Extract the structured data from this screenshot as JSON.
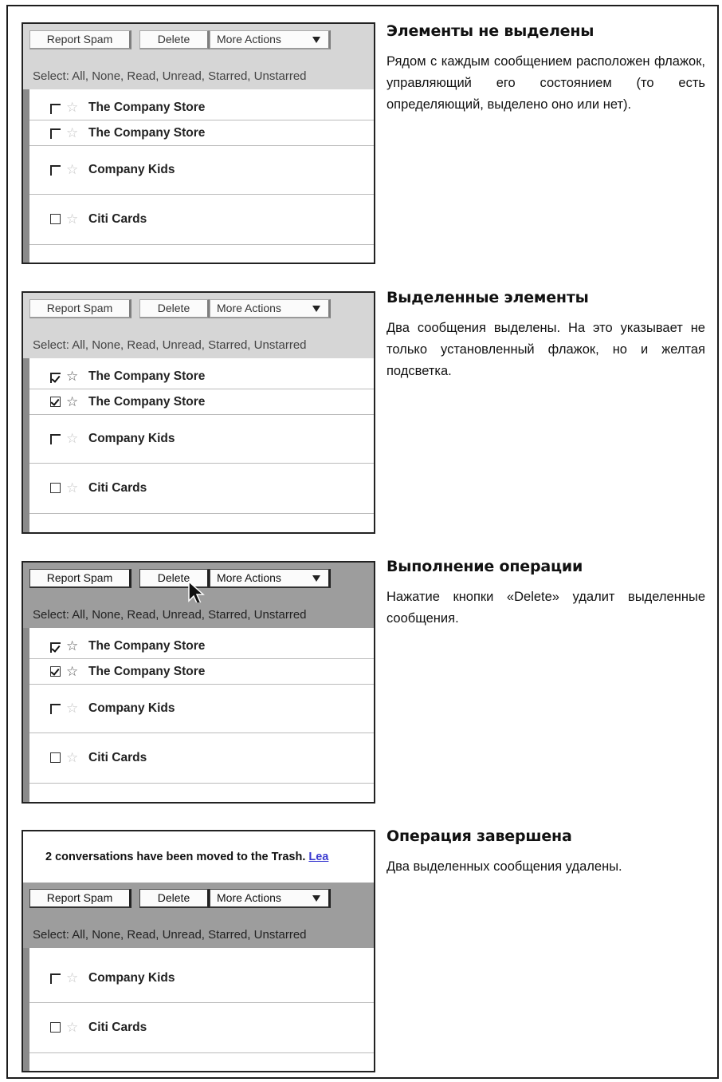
{
  "toolbar": {
    "report_spam": "Report Spam",
    "delete": "Delete",
    "more_actions": "More Actions",
    "select_line": "Select: All, None, Read, Unread, Starred, Unstarred"
  },
  "rows": {
    "store1": "The Company Store",
    "store2": "The Company Store",
    "kids": "Company Kids",
    "citi": "Citi Cards"
  },
  "sections": [
    {
      "heading": "Элементы не выделены",
      "text": "Рядом с каждым сообщением расположен флажок, управляющий его состоянием (то есть определяющий, выделено оно или нет)."
    },
    {
      "heading": "Выделенные элементы",
      "text": "Два сообщения выделены. На это указывает не только установленный флажок, но и желтая подсветка."
    },
    {
      "heading": "Выполнение операции",
      "text": "Нажатие кнопки «Delete» удалит выделенные сообщения."
    },
    {
      "heading": "Операция завершена",
      "text": "Два выделенных сообщения удалены."
    }
  ],
  "notice": {
    "text": "2 conversations have been moved to the Trash.",
    "link": "Lea"
  },
  "colors": {
    "light_toolbar": "#d6d6d6",
    "dark_toolbar": "#9d9d9d",
    "link": "#3a3ad0"
  }
}
